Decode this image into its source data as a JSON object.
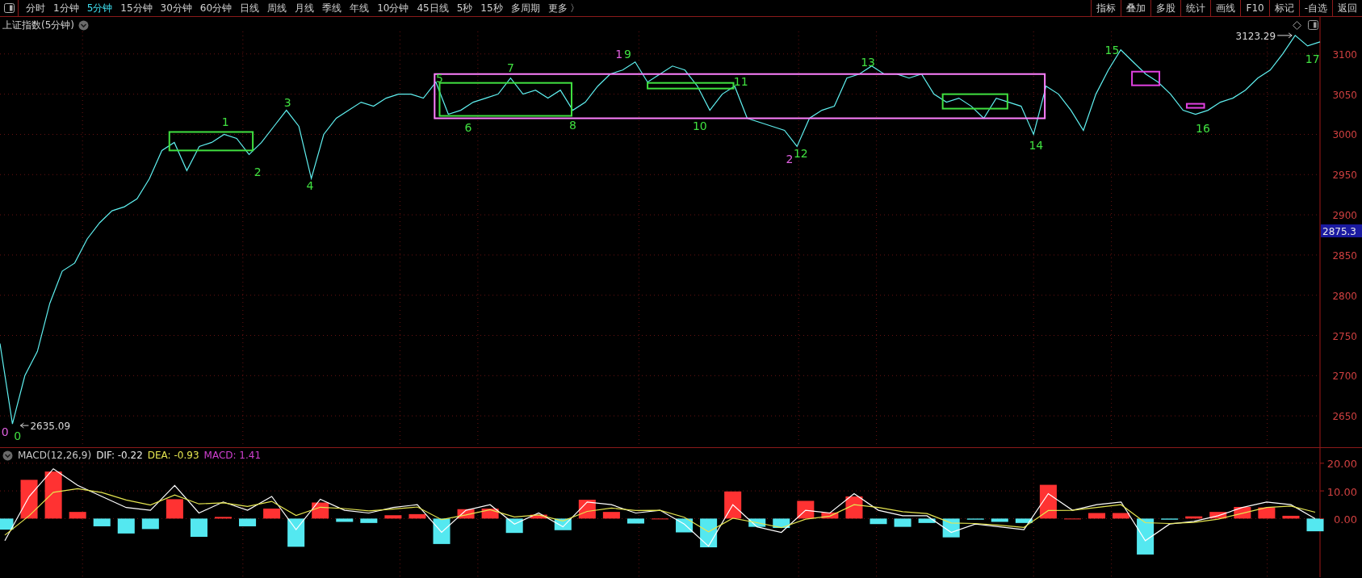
{
  "toolbar": {
    "periods": [
      {
        "label": "分时",
        "selected": false
      },
      {
        "label": "1分钟",
        "selected": false
      },
      {
        "label": "5分钟",
        "selected": true
      },
      {
        "label": "15分钟",
        "selected": false
      },
      {
        "label": "30分钟",
        "selected": false
      },
      {
        "label": "60分钟",
        "selected": false
      },
      {
        "label": "日线",
        "selected": false
      },
      {
        "label": "周线",
        "selected": false
      },
      {
        "label": "月线",
        "selected": false
      },
      {
        "label": "季线",
        "selected": false
      },
      {
        "label": "年线",
        "selected": false
      },
      {
        "label": "10分钟",
        "selected": false
      },
      {
        "label": "45日线",
        "selected": false
      },
      {
        "label": "5秒",
        "selected": false
      },
      {
        "label": "15秒",
        "selected": false
      },
      {
        "label": "多周期",
        "selected": false
      },
      {
        "label": "更多 〉",
        "selected": false
      }
    ],
    "tools": [
      "指标",
      "叠加",
      "多股",
      "统计",
      "画线",
      "F10",
      "标记",
      "-自选",
      "返回"
    ]
  },
  "price_panel": {
    "title": "上证指数(5分钟)",
    "chart_data": {
      "type": "line",
      "grid": true,
      "ylim": [
        2611,
        3146
      ],
      "yticks": [
        3100,
        3050,
        3000,
        2950,
        2900,
        2850,
        2800,
        2750,
        2700,
        2650
      ],
      "categories": [
        null,
        null,
        null,
        null,
        null,
        null,
        null,
        null,
        null,
        null,
        null,
        null,
        null,
        null,
        null,
        null,
        null,
        null,
        null,
        null,
        null,
        null,
        null,
        null,
        null,
        null,
        null,
        null,
        null,
        null,
        null,
        null,
        null,
        null,
        null,
        null,
        null,
        null,
        null,
        null,
        null,
        null,
        null,
        null,
        null,
        null,
        null,
        null,
        null,
        null,
        null,
        null,
        null,
        null,
        null,
        null,
        null,
        null,
        null,
        null,
        null,
        null,
        null,
        null,
        null,
        null,
        null,
        null,
        null,
        null,
        null,
        null,
        null,
        null,
        null,
        null,
        null,
        null,
        null,
        null,
        null,
        null,
        null,
        null,
        null,
        null,
        null,
        null,
        null,
        null,
        null,
        null,
        null,
        null,
        null,
        null,
        null,
        null,
        null,
        null,
        null,
        null,
        null,
        null,
        null,
        null,
        null
      ],
      "series": [
        {
          "color": "#5ff0f0",
          "values": [
            2740,
            2640,
            2700,
            2730,
            2790,
            2830,
            2840,
            2870,
            2890,
            2905,
            2910,
            2920,
            2945,
            2980,
            2990,
            2955,
            2985,
            2990,
            3000,
            2995,
            2975,
            2990,
            3010,
            3030,
            3010,
            2945,
            3000,
            3020,
            3030,
            3040,
            3035,
            3045,
            3050,
            3050,
            3045,
            3065,
            3025,
            3030,
            3040,
            3045,
            3050,
            3070,
            3050,
            3055,
            3045,
            3055,
            3030,
            3040,
            3060,
            3075,
            3080,
            3090,
            3065,
            3075,
            3085,
            3080,
            3060,
            3030,
            3050,
            3060,
            3020,
            3015,
            3010,
            3005,
            2985,
            3020,
            3030,
            3035,
            3070,
            3075,
            3085,
            3075,
            3075,
            3070,
            3075,
            3050,
            3040,
            3045,
            3035,
            3020,
            3045,
            3040,
            3035,
            3000,
            3060,
            3050,
            3030,
            3005,
            3050,
            3080,
            3105,
            3090,
            3075,
            3065,
            3050,
            3030,
            3025,
            3030,
            3040,
            3045,
            3055,
            3070,
            3080,
            3100,
            3123,
            3110,
            3115
          ]
        }
      ],
      "annotations": [
        "0",
        "0",
        "1",
        "2",
        "3",
        "4",
        "5",
        "6",
        "7",
        "8",
        "1",
        "9",
        "10",
        "11",
        "2",
        "12",
        "13",
        "14",
        "15",
        "16",
        "17",
        "3123.29",
        "2635.09",
        "2875.3"
      ]
    },
    "annotation_styles": [
      {
        "kind": "wave",
        "color": "#e060e0"
      },
      {
        "kind": "wave",
        "color": "#40e040"
      },
      {
        "kind": "wave",
        "color": "#40e040"
      },
      {
        "kind": "wave",
        "color": "#40e040"
      },
      {
        "kind": "wave",
        "color": "#40e040"
      },
      {
        "kind": "wave",
        "color": "#40e040"
      },
      {
        "kind": "wave",
        "color": "#40e040"
      },
      {
        "kind": "wave",
        "color": "#40e040"
      },
      {
        "kind": "wave",
        "color": "#40e040"
      },
      {
        "kind": "wave",
        "color": "#40e040"
      },
      {
        "kind": "wave",
        "color": "#e060e0"
      },
      {
        "kind": "wave",
        "color": "#40e040"
      },
      {
        "kind": "wave",
        "color": "#40e040"
      },
      {
        "kind": "wave",
        "color": "#40e040"
      },
      {
        "kind": "wave",
        "color": "#e060e0"
      },
      {
        "kind": "wave",
        "color": "#40e040"
      },
      {
        "kind": "wave",
        "color": "#40e040"
      },
      {
        "kind": "wave",
        "color": "#40e040"
      },
      {
        "kind": "wave",
        "color": "#40e040"
      },
      {
        "kind": "wave",
        "color": "#40e040"
      },
      {
        "kind": "wave",
        "color": "#40e040"
      },
      {
        "kind": "max",
        "color": "#d8d8d8"
      },
      {
        "kind": "min",
        "color": "#d8d8d8"
      },
      {
        "kind": "price_tag",
        "color": "#1a1aa0"
      }
    ],
    "boxes": [
      {
        "color": "#40e040"
      },
      {
        "color": "#ff80ff"
      },
      {
        "color": "#40e040"
      },
      {
        "color": "#40e040"
      },
      {
        "color": "#40e040"
      },
      {
        "color": "#e040e0"
      },
      {
        "color": "#e040e0"
      }
    ]
  },
  "macd_panel": {
    "legend": [
      {
        "text": "MACD(12,26,9)",
        "color": "#c8c8c8"
      },
      {
        "text": "DIF: -0.22",
        "color": "#e8e8e8"
      },
      {
        "text": "DEA: -0.93",
        "color": "#e6e650"
      },
      {
        "text": "MACD: 1.41",
        "color": "#d040d0"
      }
    ],
    "chart_data": {
      "type": "bar",
      "grid": true,
      "stacked": true,
      "ylim": [
        -21.2,
        25.5
      ],
      "yticks": [
        {
          "value": 20,
          "label": "20.00"
        },
        {
          "value": 10,
          "label": "10.00"
        },
        {
          "value": 0,
          "label": "0.00"
        }
      ],
      "categories": [
        null,
        null,
        null,
        null,
        null,
        null,
        null,
        null,
        null,
        null,
        null,
        null,
        null,
        null,
        null,
        null,
        null,
        null,
        null,
        null,
        null,
        null,
        null,
        null,
        null,
        null,
        null,
        null,
        null,
        null,
        null,
        null,
        null,
        null,
        null,
        null,
        null,
        null,
        null,
        null,
        null,
        null,
        null,
        null,
        null,
        null,
        null,
        null,
        null,
        null,
        null,
        null,
        null,
        null,
        null
      ],
      "series": [
        {
          "color": "#ff3232",
          "values": [
            null,
            14,
            17,
            2.4,
            null,
            null,
            null,
            7,
            null,
            0.6,
            null,
            3.6,
            null,
            5.8,
            null,
            null,
            1.2,
            1.6,
            null,
            3.4,
            3.6,
            null,
            1.4,
            null,
            6.8,
            2.4,
            null,
            0,
            null,
            null,
            9.8,
            null,
            null,
            6.4,
            2.2,
            8,
            null,
            null,
            null,
            null,
            null,
            null,
            null,
            12.2,
            0,
            2,
            2,
            null,
            null,
            0.8,
            2.4,
            4.2,
            4,
            1,
            null
          ]
        },
        {
          "color": "#54e8f0",
          "values": [
            -4,
            null,
            null,
            null,
            -2.8,
            -5.4,
            -3.8,
            null,
            -6.6,
            null,
            -2.8,
            null,
            -10.2,
            null,
            -1.2,
            -1.6,
            null,
            null,
            -9.2,
            null,
            null,
            -5.2,
            null,
            -4.2,
            null,
            null,
            -1.8,
            null,
            -5,
            -10.4,
            null,
            -3,
            -3.4,
            null,
            null,
            null,
            -2,
            -3,
            -1.6,
            -6.8,
            -0.4,
            -1.2,
            -1.6,
            null,
            null,
            null,
            null,
            -13,
            -0.4,
            null,
            null,
            null,
            null,
            null,
            -4.6
          ]
        },
        {
          "type": "line",
          "color": "#ffffff",
          "values": [
            -8,
            8,
            18,
            12,
            8,
            4,
            3,
            12,
            2,
            6,
            3,
            8,
            -4,
            7,
            3,
            2,
            4,
            5,
            -5,
            3,
            5,
            -2,
            2,
            -3,
            6,
            5,
            2,
            3,
            -2,
            -10,
            5,
            -3,
            -5,
            3,
            2,
            9,
            3,
            1,
            1,
            -5,
            -2,
            -3,
            -4,
            9,
            3,
            5,
            6,
            -8,
            -2,
            -1,
            1,
            4,
            6,
            5,
            0
          ]
        },
        {
          "type": "line",
          "color": "#e6e650",
          "values": [
            -6,
            1,
            9.5,
            10.8,
            9.4,
            6.7,
            4.9,
            8.5,
            5.3,
            5.7,
            4.4,
            6.2,
            1.1,
            4.1,
            3.6,
            2.8,
            3.4,
            4.2,
            -0.4,
            1.3,
            3.2,
            0.6,
            1.3,
            -0.9,
            2.6,
            3.8,
            2.9,
            3,
            0.5,
            -4.8,
            0.1,
            -1.5,
            -3.3,
            -0.2,
            0.9,
            5,
            4,
            2.5,
            1.8,
            -1.6,
            -1.8,
            -2.4,
            -3.2,
            2.9,
            3,
            4,
            5,
            -1.5,
            -1.8,
            -1.4,
            -0.2,
            1.9,
            4,
            4.5,
            2.3
          ]
        }
      ]
    }
  }
}
